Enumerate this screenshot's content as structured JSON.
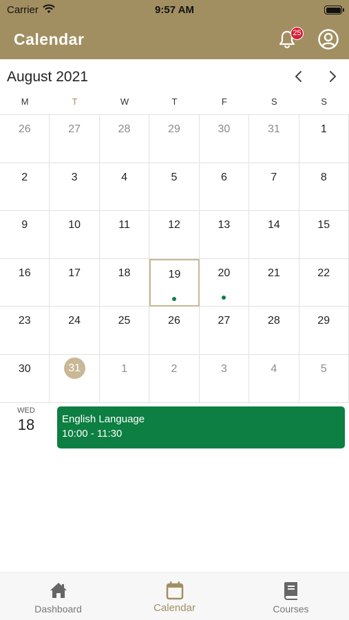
{
  "status": {
    "carrier": "Carrier",
    "time": "9:57 AM"
  },
  "header": {
    "title": "Calendar",
    "badge_count": "25"
  },
  "month": {
    "label": "August 2021"
  },
  "weekdays": [
    "M",
    "T",
    "W",
    "T",
    "F",
    "S",
    "S"
  ],
  "days": [
    "26",
    "27",
    "28",
    "29",
    "30",
    "31",
    "1",
    "2",
    "3",
    "4",
    "5",
    "6",
    "7",
    "8",
    "9",
    "10",
    "11",
    "12",
    "13",
    "14",
    "15",
    "16",
    "17",
    "18",
    "19",
    "20",
    "21",
    "22",
    "23",
    "24",
    "25",
    "26",
    "27",
    "28",
    "29",
    "30",
    "31",
    "1",
    "2",
    "3",
    "4",
    "5"
  ],
  "agenda": {
    "weekday": "WED",
    "date": "18",
    "event": {
      "title": "English Language",
      "time": "10:00 - 11:30"
    }
  },
  "tabs": [
    {
      "label": "Dashboard"
    },
    {
      "label": "Calendar"
    },
    {
      "label": "Courses"
    }
  ],
  "colors": {
    "header": "#a28f61",
    "event": "#0d7f42",
    "badge": "#d42138",
    "today": "#c9b796"
  }
}
